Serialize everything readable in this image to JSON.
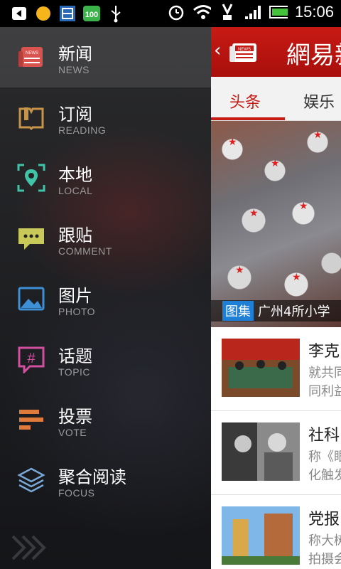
{
  "status_bar": {
    "time": "15:06",
    "left_icons": [
      "back-icon",
      "weather-sun-icon",
      "calendar-app-icon",
      "app-100-icon",
      "usb-icon"
    ],
    "right_icons": [
      "alarm-icon",
      "wifi-icon",
      "vibrate-icon",
      "signal-icon",
      "battery-icon"
    ]
  },
  "drawer": {
    "items": [
      {
        "label": "新闻",
        "sub": "NEWS",
        "icon": "news-icon",
        "color": "#d9534f",
        "active": true
      },
      {
        "label": "订阅",
        "sub": "READING",
        "icon": "book-icon",
        "color": "#c8944a"
      },
      {
        "label": "本地",
        "sub": "LOCAL",
        "icon": "location-icon",
        "color": "#3fc4a8"
      },
      {
        "label": "跟贴",
        "sub": "COMMENT",
        "icon": "comment-icon",
        "color": "#c9c95a"
      },
      {
        "label": "图片",
        "sub": "PHOTO",
        "icon": "photo-icon",
        "color": "#3d8fd6"
      },
      {
        "label": "话题",
        "sub": "TOPIC",
        "icon": "hashtag-icon",
        "color": "#d04f9e"
      },
      {
        "label": "投票",
        "sub": "VOTE",
        "icon": "vote-icon",
        "color": "#e07a3a"
      },
      {
        "label": "聚合阅读",
        "sub": "FOCUS",
        "icon": "layers-icon",
        "color": "#7aa8d6"
      }
    ],
    "more_icon": "double-chevron-right-icon"
  },
  "content": {
    "brand": "網易新",
    "tabs": [
      "头条",
      "娱乐"
    ],
    "hero": {
      "tag": "图集",
      "title": "广州4所小学"
    },
    "articles": [
      {
        "title": "李克",
        "lines": [
          "就共同",
          "同利益"
        ]
      },
      {
        "title": "社科",
        "lines": [
          "称《眼",
          "化触发"
        ]
      },
      {
        "title": "党报",
        "lines": [
          "称大树",
          "拍摄会"
        ]
      }
    ]
  },
  "colors": {
    "brand_red": "#c81a14",
    "drawer_bg": "#1c1d20",
    "caption_tag": "#1d7fd6"
  }
}
